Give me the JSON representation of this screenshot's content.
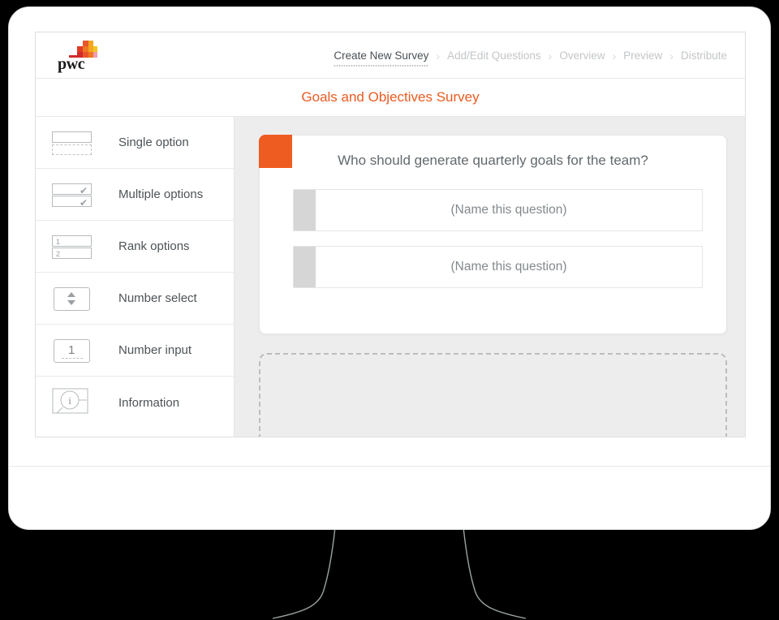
{
  "brand": {
    "logo_text": "pwc",
    "accent_color": "#ef5c22",
    "title_color": "#ea5b21"
  },
  "breadcrumb": {
    "separator": "›",
    "items": [
      {
        "label": "Create New Survey",
        "active": true
      },
      {
        "label": "Add/Edit Questions",
        "active": false
      },
      {
        "label": "Overview",
        "active": false
      },
      {
        "label": "Preview",
        "active": false
      },
      {
        "label": "Distribute",
        "active": false
      }
    ]
  },
  "header": {
    "survey_title": "Goals and Objectives Survey"
  },
  "sidebar": {
    "items": [
      {
        "label": "Single option",
        "icon": "single-option-icon"
      },
      {
        "label": "Multiple options",
        "icon": "multiple-options-icon"
      },
      {
        "label": "Rank options",
        "icon": "rank-options-icon"
      },
      {
        "label": "Number select",
        "icon": "number-select-icon"
      },
      {
        "label": "Number input",
        "icon": "number-input-icon"
      },
      {
        "label": "Information",
        "icon": "information-icon"
      }
    ],
    "rank_numbers": [
      "1",
      "2"
    ],
    "number_input_value": "1",
    "check_glyph": "✔",
    "info_glyph": "i"
  },
  "question_card": {
    "title": "Who should generate quarterly goals for the team?",
    "answers": [
      {
        "placeholder": "(Name this question)"
      },
      {
        "placeholder": "(Name this question)"
      }
    ]
  },
  "dropzone": {
    "label": ""
  }
}
